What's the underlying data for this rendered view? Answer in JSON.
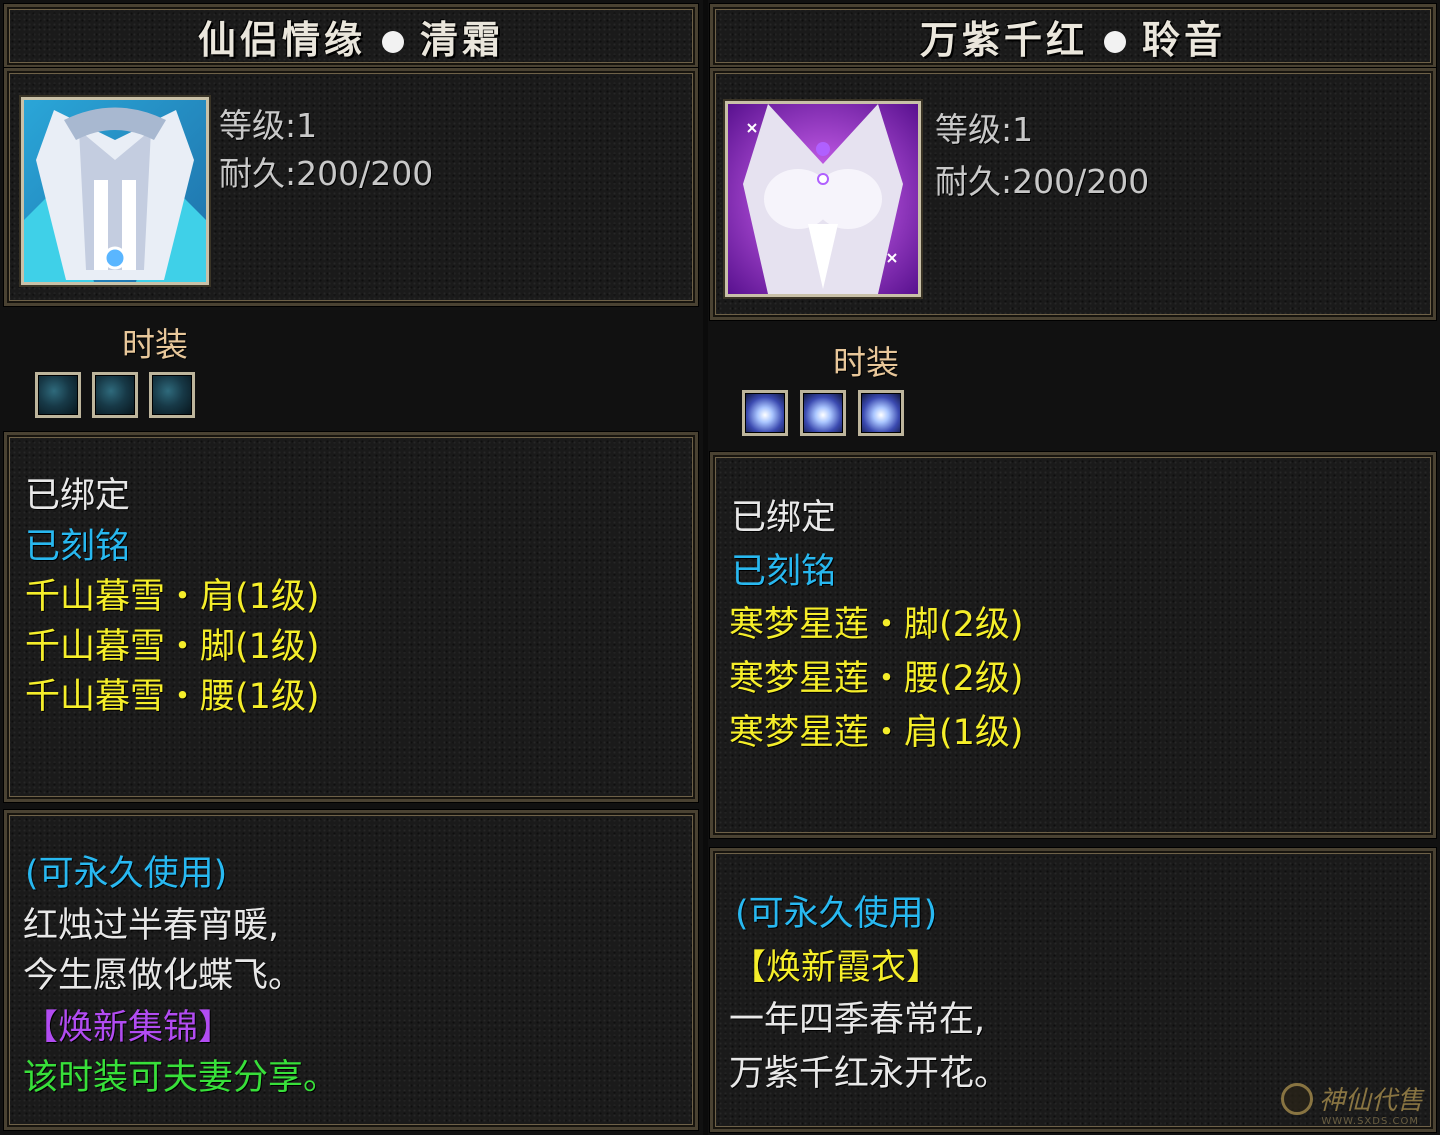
{
  "left": {
    "title_left": "仙侣情缘",
    "title_right": "清霜",
    "level": "等级:1",
    "durability": "耐久:200/200",
    "section_label": "时装",
    "slots": [
      "slot",
      "slot",
      "slot"
    ],
    "bound": "已绑定",
    "engraved": "已刻铭",
    "sets": [
      "千山暮雪・肩(1级)",
      "千山暮雪・脚(1级)",
      "千山暮雪・腰(1级)"
    ],
    "usage": "(可永久使用)",
    "poem": [
      "红烛过半春宵暖,",
      "今生愿做化蝶飞。"
    ],
    "tag": "【焕新集锦】",
    "share": "该时装可夫妻分享。"
  },
  "right": {
    "title_left": "万紫千红",
    "title_right": "聆音",
    "level": "等级:1",
    "durability": "耐久:200/200",
    "section_label": "时装",
    "slots": [
      "slot",
      "slot",
      "slot"
    ],
    "bound": "已绑定",
    "engraved": "已刻铭",
    "sets": [
      "寒梦星莲・脚(2级)",
      "寒梦星莲・腰(2级)",
      "寒梦星莲・肩(1级)"
    ],
    "usage": "(可永久使用)",
    "tag": "【焕新霞衣】",
    "poem": [
      "一年四季春常在,",
      "万紫千红永开花。"
    ]
  },
  "watermark": {
    "text": "神仙代售",
    "url": "WWW.SXDS.COM"
  },
  "colors": {
    "white": "#e8e8e8",
    "cyan": "#28b8f0",
    "yellow": "#f5ee2a",
    "purple": "#b24cf2",
    "green": "#38e03a",
    "gold": "#e8c79a"
  }
}
